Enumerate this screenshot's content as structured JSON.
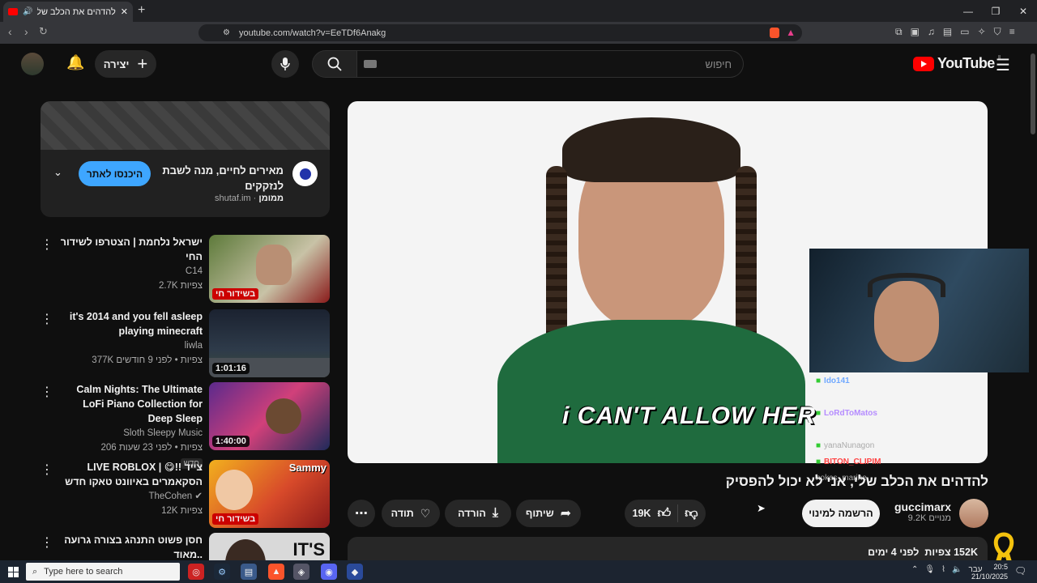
{
  "browser": {
    "tab_title": "להדהים את הכלב שלי, אני לא",
    "url": "youtube.com/watch?v=EeTDf6Anakg",
    "window_controls": [
      "—",
      "❐",
      "✕"
    ]
  },
  "header": {
    "search_placeholder": "חיפוש",
    "create_label": "יצירה",
    "logo_text": "YouTube",
    "logo_region": "IL"
  },
  "ad": {
    "title": "מאירים לחיים, מנה לשבת לנזקקים",
    "sponsored": "ממומן",
    "domain": "shutaf.im",
    "cta": "היכנסו לאתר"
  },
  "suggestions": [
    {
      "title": "ישראל נלחמת | הצטרפו לשידור החי",
      "channel": "C14",
      "views": "2.7K צפיות",
      "badge": "בשידור חי"
    },
    {
      "title": "it's 2014 and you fell asleep playing minecraft",
      "channel": "liwla",
      "views": "377K צפיות • לפני 9 חודשים",
      "duration": "1:01:16"
    },
    {
      "title": "Calm Nights: The Ultimate LoFi Piano Collection for Deep Sleep",
      "channel": "Sloth Sleepy Music",
      "views": "206 צפיות • לפני 23 שעות",
      "extra": "חדש",
      "duration": "1:40:00"
    },
    {
      "title": "LIVE ROBLOX | 😋!! צייד הסקאמרים באיוונט טאקו חדש",
      "channel": "TheCohen",
      "views": "12K צפיות",
      "badge": "בשידור חי",
      "thumb_text": "Sammy"
    },
    {
      "title": "חסן פשוט התנהג בצורה גרועה מאוד..",
      "thumb_text": "IT'S"
    }
  ],
  "video": {
    "caption": "i CAN'T ALLOW HER",
    "title": "להדהים את הכלב שלי, אני לא יכול להפסיק",
    "channel": "guccimarx",
    "subscribers": "9.2K מנויים",
    "subscribe_label": "הרשמה למינוי",
    "likes": "19K",
    "share_label": "שיתוף",
    "download_label": "הורדה",
    "thanks_label": "תודה",
    "views": "152K צפיות",
    "age": "לפני 4 ימים"
  },
  "chat": [
    {
      "user": "Ido141",
      "color": "#6fa8ff",
      "msg": ""
    },
    {
      "user": "LoRdToMatos",
      "color": "#b58cff",
      "msg": ""
    },
    {
      "user": "yanaNunagon",
      "color": "#aaaaaa",
      "msg": ""
    },
    {
      "user": "BITON_CLIPIM",
      "color": "#ff4444",
      "msg": ""
    },
    {
      "user": "hokas_marine",
      "color": "#aaaaaa",
      "msg": ""
    }
  ],
  "taskbar": {
    "search_placeholder": "Type here to search",
    "lang": "עבר",
    "time": "20:5",
    "date": "21/10/2025"
  },
  "colors": {
    "accent_red": "#ff0000",
    "cta_blue": "#3ea6ff",
    "live_red": "#cc0000"
  }
}
